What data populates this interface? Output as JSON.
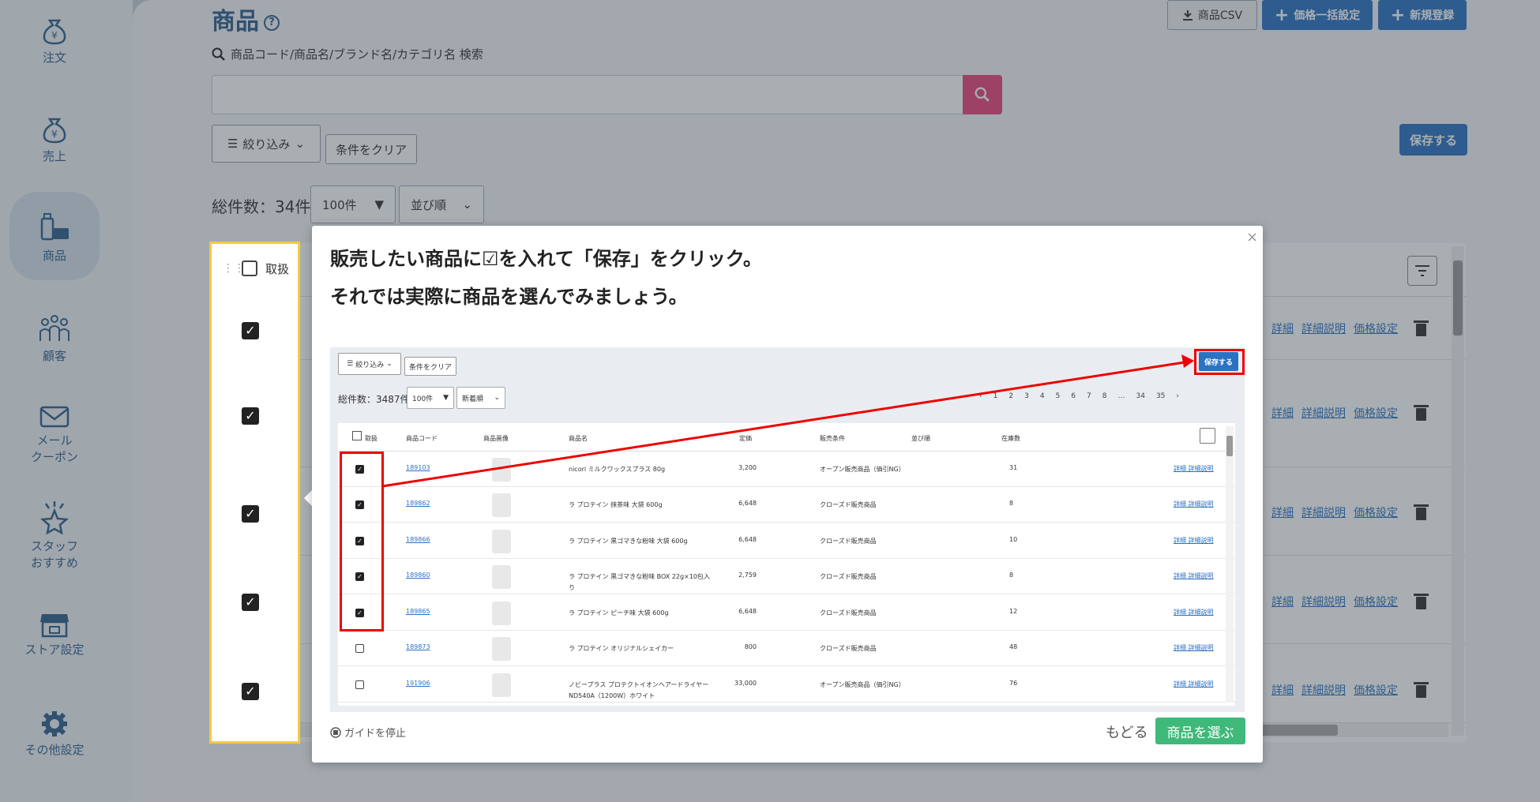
{
  "sidebar": {
    "items": [
      {
        "label": "注文",
        "icon": "yen-bag-icon"
      },
      {
        "label": "売上",
        "icon": "yen-bag-icon"
      },
      {
        "label": "商品",
        "icon": "product-icon"
      },
      {
        "label": "顧客",
        "icon": "customers-icon"
      },
      {
        "label": "メール\nクーポン",
        "icon": "mail-icon"
      },
      {
        "label": "スタッフ\nおすすめ",
        "icon": "star-icon"
      },
      {
        "label": "ストア設定",
        "icon": "store-icon"
      },
      {
        "label": "その他設定",
        "icon": "gear-icon"
      }
    ]
  },
  "header": {
    "title": "商品",
    "help": "?",
    "csv_label": "商品CSV",
    "bulk_price_label": "価格一括設定",
    "new_label": "新規登録"
  },
  "search": {
    "label": "商品コード/商品名/ブランド名/カテゴリ名 検索",
    "placeholder": ""
  },
  "filters": {
    "filter_label": "絞り込み",
    "clear_label": "条件をクリア",
    "save_label": "保存する"
  },
  "list": {
    "total": "総件数：34件",
    "per_page": "100件",
    "sort": "並び順",
    "header_label": "取扱",
    "row_links": [
      "詳細",
      "詳細説明",
      "価格設定"
    ]
  },
  "modal": {
    "close": "×",
    "line1": "販売したい商品に☑を入れて「保存」をクリック。",
    "line2": "それでは実際に商品を選んでみましょう。",
    "stop_guide": "ガイドを停止",
    "back": "もどる",
    "choose": "商品を選ぶ"
  },
  "guide": {
    "filter_label": "絞り込み",
    "clear_label": "条件をクリア",
    "save_label": "保存する",
    "total": "総件数：3487件",
    "per_page": "100件",
    "sort": "新着順",
    "pager": [
      "‹",
      "1",
      "2",
      "3",
      "4",
      "5",
      "6",
      "7",
      "8",
      "…",
      "34",
      "35",
      "›"
    ],
    "headers": [
      "取扱",
      "商品コード",
      "商品画像",
      "商品名",
      "定価",
      "販売条件",
      "並び順",
      "在庫数"
    ],
    "rows": [
      {
        "checked": true,
        "code": "189103",
        "name": "nicori ミルクワックスプラス 80g",
        "price": "3,200",
        "cond": "オープン販売商品（価引NG）",
        "stock": "31",
        "links": "詳細 詳細説明"
      },
      {
        "checked": true,
        "code": "189862",
        "name": "ラ プロテイン 抹茶味 大袋 600g",
        "price": "6,648",
        "cond": "クローズド販売商品",
        "stock": "8",
        "links": "詳細 詳細説明"
      },
      {
        "checked": true,
        "code": "189866",
        "name": "ラ プロテイン 黒ゴマきな粉味 大袋 600g",
        "price": "6,648",
        "cond": "クローズド販売商品",
        "stock": "10",
        "links": "詳細 詳細説明"
      },
      {
        "checked": true,
        "code": "189860",
        "name": "ラ プロテイン 黒ゴマきな粉味 BOX 22g×10包入り",
        "price": "2,759",
        "cond": "クローズド販売商品",
        "stock": "8",
        "links": "詳細 詳細説明"
      },
      {
        "checked": true,
        "code": "189865",
        "name": "ラ プロテイン ピーチ味 大袋 600g",
        "price": "6,648",
        "cond": "クローズド販売商品",
        "stock": "12",
        "links": "詳細 詳細説明"
      },
      {
        "checked": false,
        "code": "189873",
        "name": "ラ プロテイン オリジナルシェイカー",
        "price": "800",
        "cond": "クローズド販売商品",
        "stock": "48",
        "links": "詳細 詳細説明"
      },
      {
        "checked": false,
        "code": "191906",
        "name": "ノビープラス プロテクトイオンヘアードライヤーND540A（1200W）ホワイト",
        "price": "33,000",
        "cond": "オープン販売商品（価引NG）",
        "stock": "76",
        "links": "詳細 詳細説明"
      }
    ]
  },
  "colors": {
    "accent": "#2b72c2",
    "highlight": "#f6c945",
    "guide_red": "#e00000",
    "choose": "#3fb97a",
    "search": "#e8457a"
  }
}
